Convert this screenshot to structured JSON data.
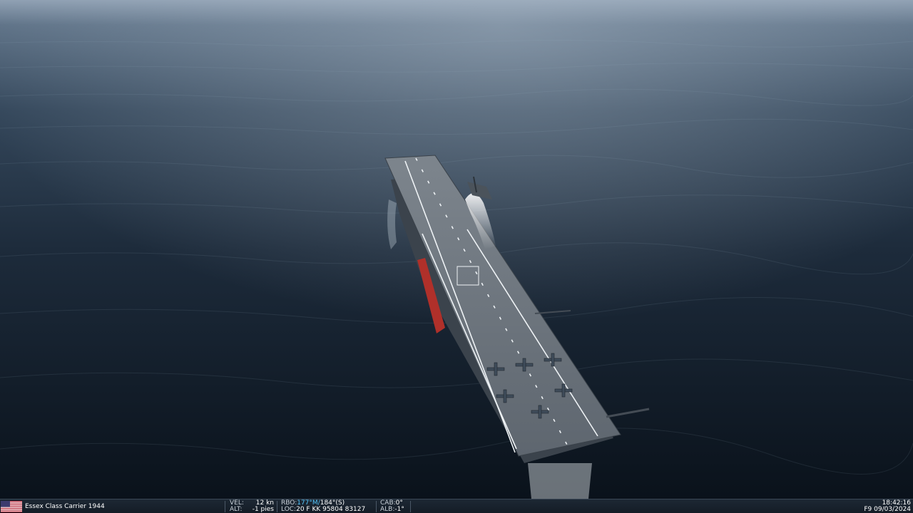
{
  "status": {
    "unit_name": "Essex Class Carrier 1944",
    "flag": "us-flag-icon",
    "vel_label": "VEL:",
    "vel_value": "12 kn",
    "alt_label": "ALT:",
    "alt_value": "-1 pies",
    "rbo_label": "RBO:",
    "rbo_mag": "177°M/",
    "rbo_true": "184°(S)",
    "loc_label": "LOC:",
    "loc_value": "20 F KK 95804 83127",
    "cab_label": "CAB:",
    "cab_value": "0°",
    "alb_label": "ALB:",
    "alb_value": "-1°",
    "time": "18:42:16",
    "date": "F9 09/03/2024"
  },
  "colors": {
    "sea": "#1a2a3a",
    "deck": "#6f7780",
    "hull_red": "#b0302a",
    "status_bg": "#1a2430",
    "highlight": "#56c8ff"
  }
}
